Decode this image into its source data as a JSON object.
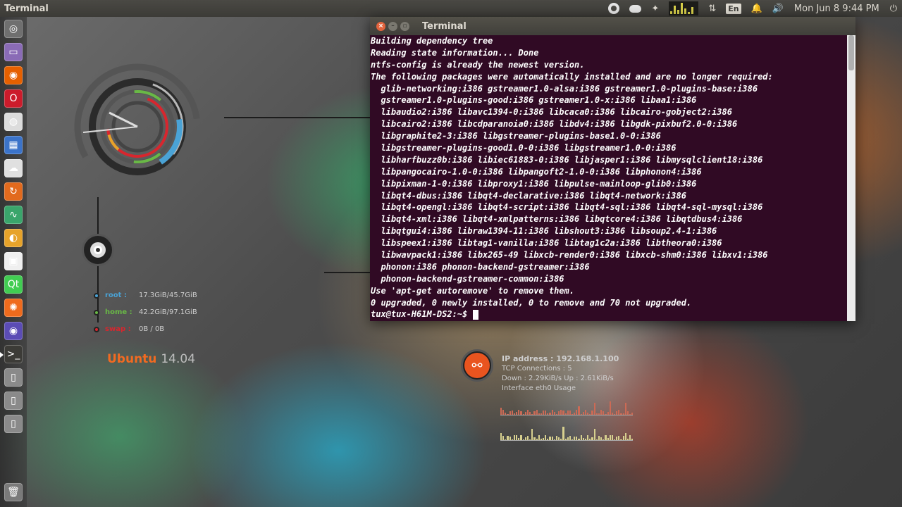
{
  "panel": {
    "app_title": "Terminal",
    "keyboard_layout": "En",
    "clock": "Mon Jun 8  9:44 PM"
  },
  "launcher": {
    "items": [
      {
        "name": "dash-home",
        "icon": "ubuntu-icon",
        "color": "#6f6f6f"
      },
      {
        "name": "files",
        "icon": "folder-icon",
        "color": "#8a6bb6"
      },
      {
        "name": "firefox",
        "icon": "firefox-icon",
        "color": "#e66000"
      },
      {
        "name": "opera",
        "icon": "opera-icon",
        "color": "#cc1b2b"
      },
      {
        "name": "chrome",
        "icon": "chrome-icon",
        "color": "#dcdcdc"
      },
      {
        "name": "apps-grid",
        "icon": "grid-icon",
        "color": "#3b73c9"
      },
      {
        "name": "cloud",
        "icon": "cloud-icon",
        "color": "#e0e0e0"
      },
      {
        "name": "software-updater",
        "icon": "refresh-icon",
        "color": "#e26a1d"
      },
      {
        "name": "system-monitor",
        "icon": "pulse-icon",
        "color": "#3aa56b"
      },
      {
        "name": "sound",
        "icon": "speaker-icon",
        "color": "#e7a32a"
      },
      {
        "name": "app-store",
        "icon": "blocks-icon",
        "color": "#efefef"
      },
      {
        "name": "qt-creator",
        "icon": "qt-icon",
        "color": "#41cd52"
      },
      {
        "name": "settings",
        "icon": "sun-icon",
        "color": "#ef6b1d"
      },
      {
        "name": "webcam",
        "icon": "camera-icon",
        "color": "#5b4cb5"
      },
      {
        "name": "terminal",
        "icon": "terminal-icon",
        "color": "#3c3b37"
      },
      {
        "name": "drive-1",
        "icon": "drive-icon",
        "color": "#8a8a8a"
      },
      {
        "name": "drive-2",
        "icon": "drive-icon",
        "color": "#8a8a8a"
      },
      {
        "name": "drive-3",
        "icon": "drive-icon",
        "color": "#8a8a8a"
      },
      {
        "name": "trash",
        "icon": "trash-icon",
        "color": "#7a7a7a"
      }
    ]
  },
  "conky": {
    "disks": [
      {
        "label": "root :",
        "value": "17.3GiB/45.7GiB",
        "color": "#4aa3d6"
      },
      {
        "label": "home :",
        "value": "42.2GiB/97.1GiB",
        "color": "#69b846"
      },
      {
        "label": "swap :",
        "value": "0B  / 0B",
        "color": "#d8262e"
      }
    ],
    "os_name": "Ubuntu",
    "os_version": "14.04",
    "network": {
      "ip": "IP address : 192.168.1.100",
      "connections": "TCP Connections : 5",
      "speeds": "Down :  2.29KiB/s   Up :   2.61KiB/s",
      "interface": "Interface eth0 Usage"
    }
  },
  "terminal": {
    "title": "Terminal",
    "lines": [
      "Building dependency tree",
      "Reading state information... Done",
      "ntfs-config is already the newest version.",
      "The following packages were automatically installed and are no longer required:",
      "  glib-networking:i386 gstreamer1.0-alsa:i386 gstreamer1.0-plugins-base:i386",
      "  gstreamer1.0-plugins-good:i386 gstreamer1.0-x:i386 libaa1:i386",
      "  libaudio2:i386 libavc1394-0:i386 libcaca0:i386 libcairo-gobject2:i386",
      "  libcairo2:i386 libcdparanoia0:i386 libdv4:i386 libgdk-pixbuf2.0-0:i386",
      "  libgraphite2-3:i386 libgstreamer-plugins-base1.0-0:i386",
      "  libgstreamer-plugins-good1.0-0:i386 libgstreamer1.0-0:i386",
      "  libharfbuzz0b:i386 libiec61883-0:i386 libjasper1:i386 libmysqlclient18:i386",
      "  libpangocairo-1.0-0:i386 libpangoft2-1.0-0:i386 libphonon4:i386",
      "  libpixman-1-0:i386 libproxy1:i386 libpulse-mainloop-glib0:i386",
      "  libqt4-dbus:i386 libqt4-declarative:i386 libqt4-network:i386",
      "  libqt4-opengl:i386 libqt4-script:i386 libqt4-sql:i386 libqt4-sql-mysql:i386",
      "  libqt4-xml:i386 libqt4-xmlpatterns:i386 libqtcore4:i386 libqtdbus4:i386",
      "  libqtgui4:i386 libraw1394-11:i386 libshout3:i386 libsoup2.4-1:i386",
      "  libspeex1:i386 libtag1-vanilla:i386 libtag1c2a:i386 libtheora0:i386",
      "  libwavpack1:i386 libx265-49 libxcb-render0:i386 libxcb-shm0:i386 libxv1:i386",
      "  phonon:i386 phonon-backend-gstreamer:i386",
      "  phonon-backend-gstreamer-common:i386",
      "Use 'apt-get autoremove' to remove them.",
      "0 upgraded, 0 newly installed, 0 to remove and 70 not upgraded."
    ],
    "prompt": "tux@tux-H61M-DS2:~$ "
  }
}
